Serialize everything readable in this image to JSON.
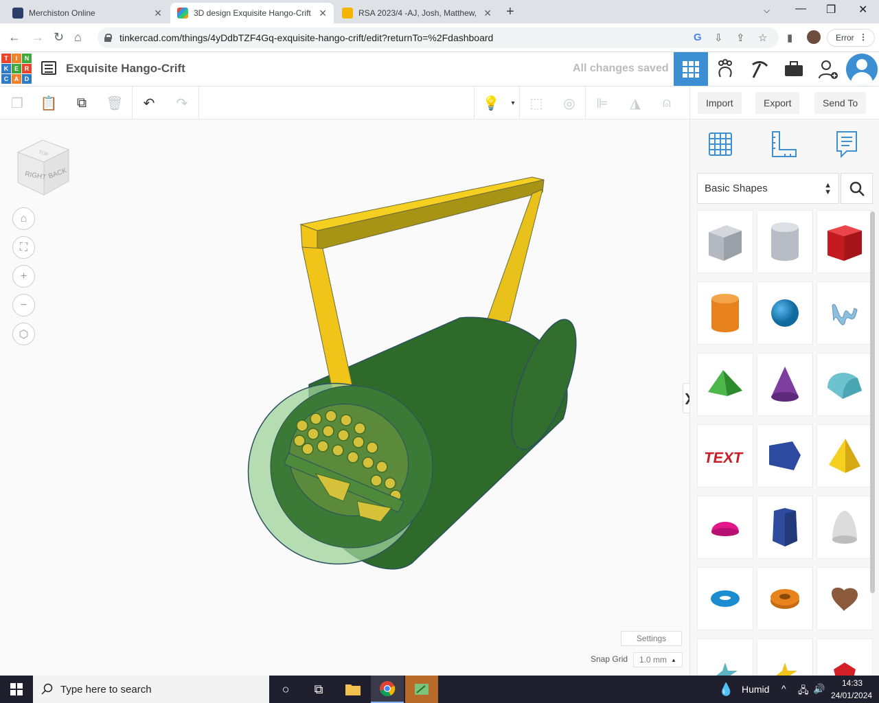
{
  "browser": {
    "tabs": [
      {
        "label": "Merchiston Online",
        "active": false
      },
      {
        "label": "3D design Exquisite Hango-Crift",
        "active": true
      },
      {
        "label": "RSA 2023/4 -AJ, Josh, Matthew,",
        "active": false
      }
    ],
    "url": "tinkercad.com/things/4yDdbTZF4Gq-exquisite-hango-crift/edit?returnTo=%2Fdashboard",
    "error_label": "Error"
  },
  "header": {
    "logo_letters": [
      "T",
      "I",
      "N",
      "K",
      "E",
      "R",
      "C",
      "A",
      "D"
    ],
    "design_title": "Exquisite Hango-Crift",
    "save_status": "All changes saved"
  },
  "toolbar": {
    "import_label": "Import",
    "export_label": "Export",
    "send_to_label": "Send To"
  },
  "viewcube": {
    "right_label": "RIGHT",
    "back_label": "BACK",
    "top_label": "TOP"
  },
  "workplane": {
    "settings_label": "Settings",
    "snap_grid_label": "Snap Grid",
    "snap_grid_value": "1.0 mm"
  },
  "shapes_panel": {
    "category": "Basic Shapes",
    "shapes": [
      {
        "name": "Box (hole)",
        "color": "#b8bcc4"
      },
      {
        "name": "Cylinder (hole)",
        "color": "#c4c8ce"
      },
      {
        "name": "Box",
        "color": "#d41f26"
      },
      {
        "name": "Cylinder",
        "color": "#e8821c"
      },
      {
        "name": "Sphere",
        "color": "#1a8ccf"
      },
      {
        "name": "Scribble",
        "color": "#7fb2d6"
      },
      {
        "name": "Roof",
        "color": "#3aa33a"
      },
      {
        "name": "Cone",
        "color": "#7d3ea0"
      },
      {
        "name": "Round Roof",
        "color": "#6cc3cf"
      },
      {
        "name": "Text",
        "color": "#c8202a"
      },
      {
        "name": "Polygon",
        "color": "#2b4aa0"
      },
      {
        "name": "Pyramid",
        "color": "#f0c419"
      },
      {
        "name": "Half Sphere",
        "color": "#e3168a"
      },
      {
        "name": "Hexagonal Prism",
        "color": "#2e4b9e"
      },
      {
        "name": "Paraboloid",
        "color": "#d8d8d8"
      },
      {
        "name": "Torus",
        "color": "#1a8ccf"
      },
      {
        "name": "Tube",
        "color": "#e8821c"
      },
      {
        "name": "Heart",
        "color": "#8b5a3c"
      }
    ]
  },
  "taskbar": {
    "search_placeholder": "Type here to search",
    "weather": "Humid",
    "time": "14:33",
    "date": "24/01/2024"
  }
}
